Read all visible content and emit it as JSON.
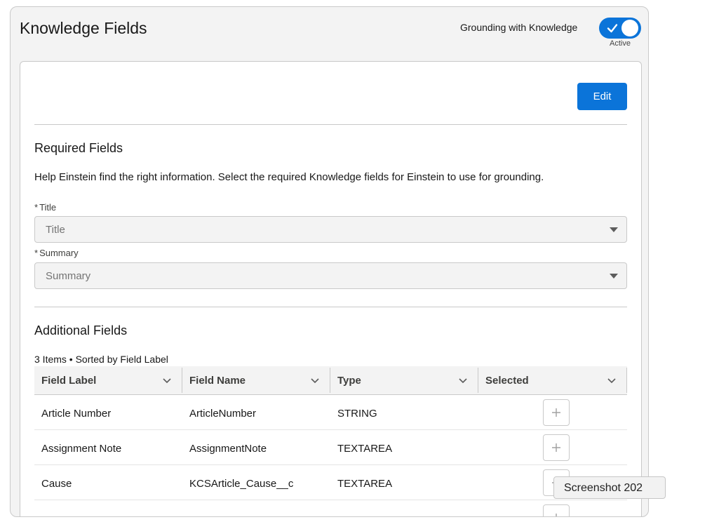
{
  "header": {
    "title": "Knowledge Fields",
    "toggle_label": "Grounding with Knowledge",
    "toggle_state": "Active",
    "toggle_on": true
  },
  "toolbar": {
    "edit_label": "Edit"
  },
  "required": {
    "title": "Required Fields",
    "help": "Help Einstein find the right information. Select the required Knowledge fields for Einstein to use for grounding.",
    "asterisk": "*",
    "fields": [
      {
        "label": "Title",
        "placeholder": "Title"
      },
      {
        "label": "Summary",
        "placeholder": "Summary"
      }
    ]
  },
  "additional": {
    "title": "Additional Fields",
    "meta": "3 Items • Sorted by Field Label",
    "columns": [
      "Field Label",
      "Field Name",
      "Type",
      "Selected"
    ],
    "rows": [
      {
        "label": "Article Number",
        "name": "ArticleNumber",
        "type": "STRING"
      },
      {
        "label": "Assignment Note",
        "name": "AssignmentNote",
        "type": "TEXTAREA"
      },
      {
        "label": "Cause",
        "name": "KCSArticle_Cause__c",
        "type": "TEXTAREA"
      }
    ]
  },
  "tooltip": {
    "text": "Screenshot 202"
  },
  "colors": {
    "accent": "#0b74d9",
    "border": "#c9c9c9",
    "panel": "#f3f3f3"
  },
  "icons": {
    "toggle": "check-icon",
    "select": "caret-down-icon",
    "column": "chevron-down-icon",
    "add": "plus-icon"
  }
}
